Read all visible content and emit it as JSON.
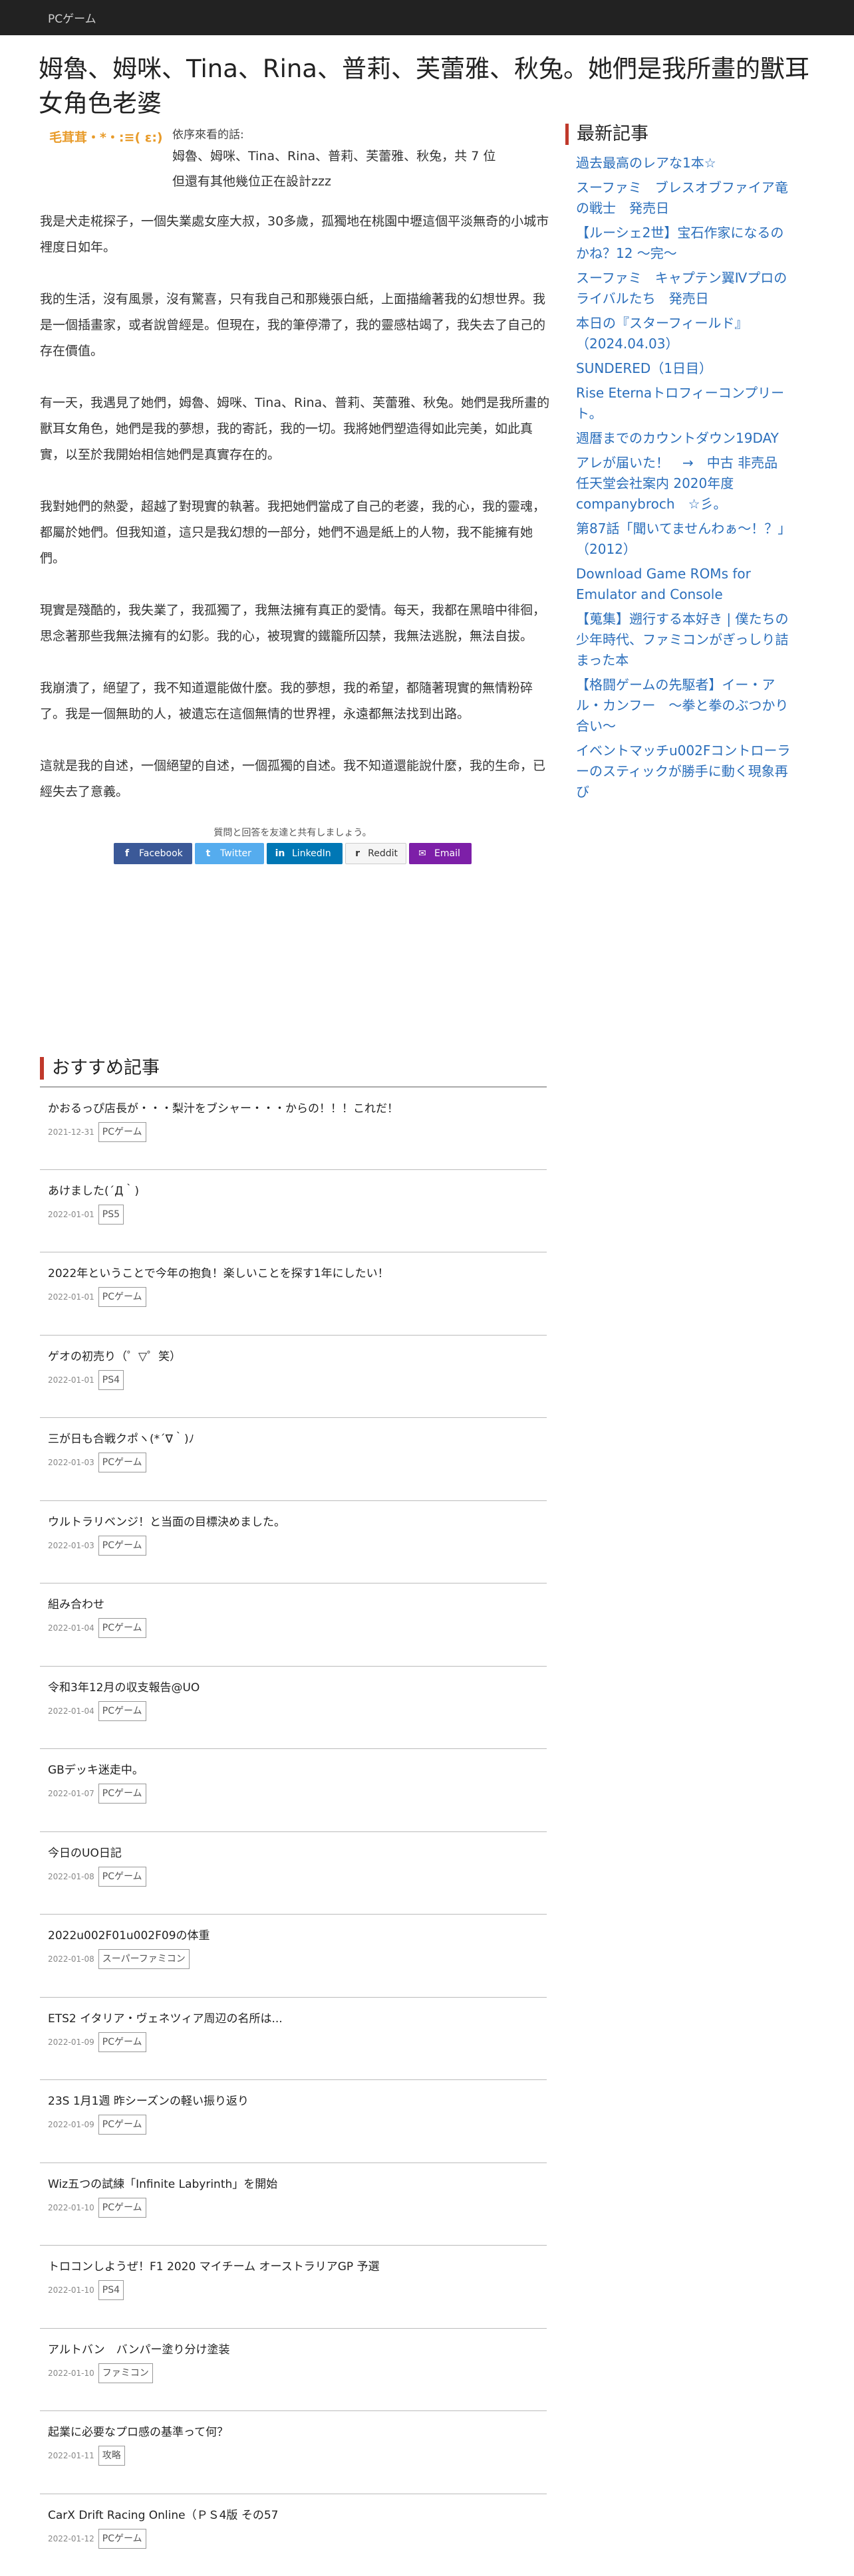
{
  "topbar": {
    "category_link": "PCゲーム"
  },
  "page_title": "姆魯、姆咪、Tina、Rina、普莉、芙蕾雅、秋兔。她們是我所畫的獸耳女角色老婆",
  "quote": {
    "name": "毛茸茸・*・:≡( ε:)",
    "label": "依序來看的話:",
    "lines": [
      "姆魯、姆咪、Tina、Rina、普莉、芙蕾雅、秋兔，共 7 位",
      "但還有其他幾位正在設計zzz"
    ]
  },
  "article": [
    "我是犬走椛探子，一個失業處女座大叔，30多歲，孤獨地在桃園中壢這個平淡無奇的小城市裡度日如年。",
    "我的生活，沒有風景，沒有驚喜，只有我自己和那幾張白紙，上面描繪著我的幻想世界。我是一個插畫家，或者說曾經是。但現在，我的筆停滯了，我的靈感枯竭了，我失去了自己的存在價值。",
    "有一天，我遇見了她們，姆魯、姆咪、Tina、Rina、普莉、芙蕾雅、秋兔。她們是我所畫的獸耳女角色，她們是我的夢想，我的寄託，我的一切。我將她們塑造得如此完美，如此真實，以至於我開始相信她們是真實存在的。",
    "我對她們的熱愛，超越了對現實的執著。我把她們當成了自己的老婆，我的心，我的靈魂，都屬於她們。但我知道，這只是我幻想的一部分，她們不過是紙上的人物，我不能擁有她們。",
    "現實是殘酷的，我失業了，我孤獨了，我無法擁有真正的愛情。每天，我都在黑暗中徘徊，思念著那些我無法擁有的幻影。我的心，被現實的鐵籠所囚禁，我無法逃脫，無法自拔。",
    "我崩潰了，絕望了，我不知道還能做什麼。我的夢想，我的希望，都隨著現實的無情粉碎了。我是一個無助的人，被遺忘在這個無情的世界裡，永遠都無法找到出路。",
    "這就是我的自述，一個絕望的自述，一個孤獨的自述。我不知道還能說什麼，我的生命，已經失去了意義。"
  ],
  "share": {
    "caption": "質問と回答を友達と共有しましょう。",
    "buttons": [
      {
        "label": "Facebook",
        "icon": "f"
      },
      {
        "label": "Twitter",
        "icon": "t"
      },
      {
        "label": "LinkedIn",
        "icon": "in"
      },
      {
        "label": "Reddit",
        "icon": "r"
      },
      {
        "label": "Email",
        "icon": "✉"
      }
    ]
  },
  "recommend": {
    "heading": "おすすめ記事",
    "items": [
      {
        "title": "かおるっぴ店長が・・・梨汁をブシャー・・・からの！！！これだ！",
        "date": "2021-12-31",
        "tag": "PCゲーム"
      },
      {
        "title": "あけました(´Д｀)",
        "date": "2022-01-01",
        "tag": "PS5"
      },
      {
        "title": "2022年ということで今年の抱負！楽しいことを探す1年にしたい！",
        "date": "2022-01-01",
        "tag": "PCゲーム"
      },
      {
        "title": "ゲオの初売り（゜▽゜笑）",
        "date": "2022-01-01",
        "tag": "PS4"
      },
      {
        "title": "三が日も合戦クポヽ(*´∇｀)ﾉ",
        "date": "2022-01-03",
        "tag": "PCゲーム"
      },
      {
        "title": "ウルトラリベンジ！と当面の目標決めました。",
        "date": "2022-01-03",
        "tag": "PCゲーム"
      },
      {
        "title": "組み合わせ",
        "date": "2022-01-04",
        "tag": "PCゲーム"
      },
      {
        "title": "令和3年12月の収支報告@UO",
        "date": "2022-01-04",
        "tag": "PCゲーム"
      },
      {
        "title": "GBデッキ迷走中。",
        "date": "2022-01-07",
        "tag": "PCゲーム"
      },
      {
        "title": "今日のUO日記",
        "date": "2022-01-08",
        "tag": "PCゲーム"
      },
      {
        "title": "2022u002F01u002F09の体重",
        "date": "2022-01-08",
        "tag": "スーパーファミコン"
      },
      {
        "title": "ETS2 イタリア・ヴェネツィア周辺の名所は...",
        "date": "2022-01-09",
        "tag": "PCゲーム"
      },
      {
        "title": "23S 1月1週 昨シーズンの軽い振り返り",
        "date": "2022-01-09",
        "tag": "PCゲーム"
      },
      {
        "title": "Wiz五つの試練「Infinite Labyrinth」を開始",
        "date": "2022-01-10",
        "tag": "PCゲーム"
      },
      {
        "title": "トロコンしようぜ！F1 2020 マイチーム オーストラリアGP 予選",
        "date": "2022-01-10",
        "tag": "PS4"
      },
      {
        "title": "アルトバン　バンパー塗り分け塗装",
        "date": "2022-01-10",
        "tag": "ファミコン"
      },
      {
        "title": "起業に必要なプロ感の基準って何？",
        "date": "2022-01-11",
        "tag": "攻略"
      },
      {
        "title": "CarX Drift Racing Online（ＰＳ4版 その57",
        "date": "2022-01-12",
        "tag": "PCゲーム"
      }
    ]
  },
  "sidebar": {
    "heading": "最新記事",
    "links": [
      "過去最高のレアな1本☆",
      "スーファミ　ブレスオブファイア竜の戦士　発売日",
      "【ルーシェ2世】宝石作家になるのかね？12 〜完〜",
      "スーファミ　キャプテン翼Ⅳプロのライバルたち　発売日",
      "本日の『スターフィールド』（2024.04.03）",
      "SUNDERED（1日目）",
      "Rise Eternaトロフィーコンプリート。",
      "週暦までのカウントダウン19DAY",
      "アレが届いた！　→　中古 非売品 任天堂会社案内 2020年度 companybroch　☆彡。",
      "第87話「聞いてませんわぁ〜！？」（2012）",
      "Download Game ROMs for Emulator and Console",
      "【蒐集】遡行する本好き | 僕たちの少年時代、ファミコンがぎっしり詰まった本",
      "【格闘ゲームの先駆者】イー・アル・カンフー　〜拳と拳のぶつかり合い〜",
      "イベントマッチu002Fコントローラーのスティックが勝手に動く現象再び"
    ]
  }
}
